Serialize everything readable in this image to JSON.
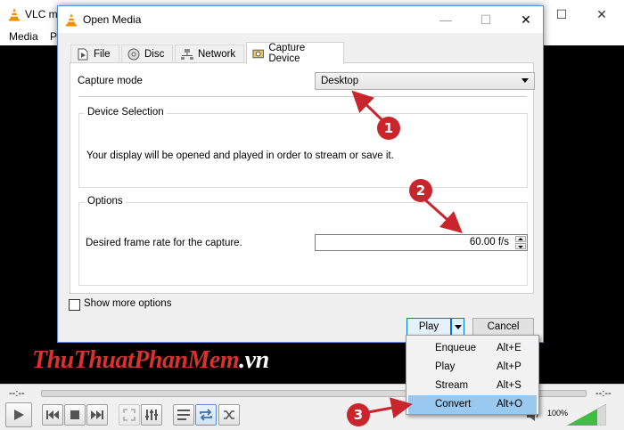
{
  "vlc": {
    "title": "VLC m",
    "menu": [
      "Media",
      "P"
    ],
    "time_left": "--:--",
    "time_right": "--:--",
    "volume": "100%",
    "watermark_a": "ThuThuat",
    "watermark_b": "PhanMem",
    "watermark_c": ".vn"
  },
  "dialog": {
    "title": "Open Media",
    "tabs": [
      {
        "label": "File",
        "icon": "file-icon"
      },
      {
        "label": "Disc",
        "icon": "disc-icon"
      },
      {
        "label": "Network",
        "icon": "network-icon"
      },
      {
        "label": "Capture Device",
        "icon": "capture-device-icon",
        "active": true
      }
    ],
    "capture_mode_label": "Capture mode",
    "capture_mode_value": "Desktop",
    "device_selection": {
      "title": "Device Selection",
      "text": "Your display will be opened and played in order to stream or save it."
    },
    "options": {
      "title": "Options",
      "frame_rate_label": "Desired frame rate for the capture.",
      "frame_rate_value": "60.00 f/s"
    },
    "show_more_options": "Show more options",
    "play_label": "Play",
    "cancel_label": "Cancel"
  },
  "play_menu": {
    "items": [
      {
        "label": "Enqueue",
        "shortcut": "Alt+E"
      },
      {
        "label": "Play",
        "shortcut": "Alt+P"
      },
      {
        "label": "Stream",
        "shortcut": "Alt+S"
      },
      {
        "label": "Convert",
        "shortcut": "Alt+O",
        "highlighted": true
      }
    ]
  },
  "annotations": {
    "badge_1": "1",
    "badge_2": "2",
    "badge_3": "3",
    "color": "#c8252c"
  }
}
